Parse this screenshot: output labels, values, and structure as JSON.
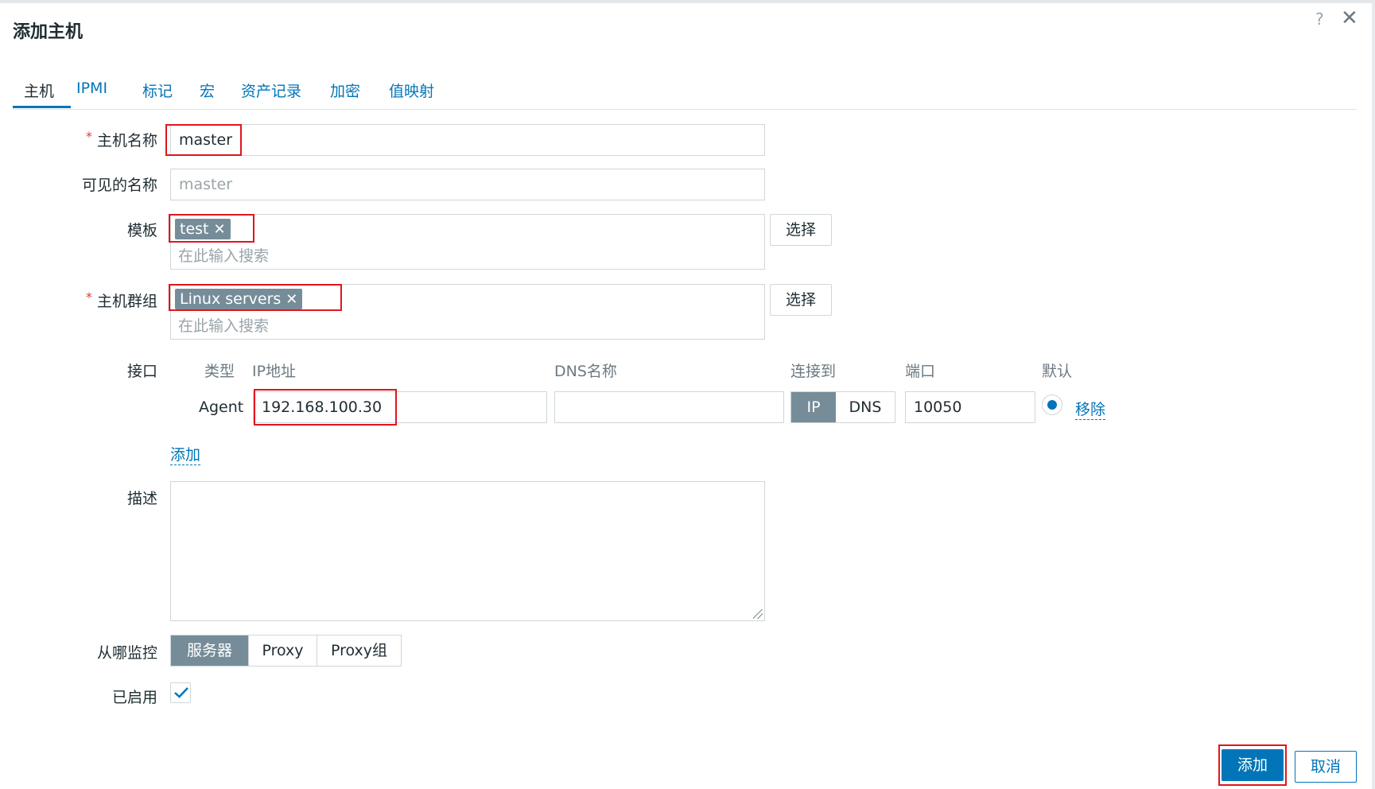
{
  "dialog": {
    "title": "添加主机",
    "help_icon": "?",
    "close_icon": "✕"
  },
  "tabs": [
    {
      "label": "主机"
    },
    {
      "label": "IPMI"
    },
    {
      "label": "标记"
    },
    {
      "label": "宏"
    },
    {
      "label": "资产记录"
    },
    {
      "label": "加密"
    },
    {
      "label": "值映射"
    }
  ],
  "form": {
    "required_mark": "*",
    "hostname": {
      "label": "主机名称",
      "value": "master"
    },
    "visible_name": {
      "label": "可见的名称",
      "placeholder": "master"
    },
    "templates": {
      "label": "模板",
      "tags": [
        "test"
      ],
      "search_placeholder": "在此输入搜索",
      "select_button": "选择"
    },
    "host_groups": {
      "label": "主机群组",
      "tags": [
        "Linux servers"
      ],
      "search_placeholder": "在此输入搜索",
      "select_button": "选择"
    },
    "tag_remove_icon": "✕",
    "interfaces": {
      "label": "接口",
      "headers": {
        "type": "类型",
        "ip": "IP地址",
        "dns": "DNS名称",
        "connect_to": "连接到",
        "port": "端口",
        "default": "默认"
      },
      "row": {
        "type": "Agent",
        "ip": "192.168.100.30",
        "dns": "",
        "connect_options": [
          "IP",
          "DNS"
        ],
        "connect_selected": "IP",
        "port": "10050",
        "remove": "移除"
      },
      "add_link": "添加"
    },
    "description": {
      "label": "描述",
      "value": ""
    },
    "monitored_by": {
      "label": "从哪监控",
      "options": [
        "服务器",
        "Proxy",
        "Proxy组"
      ],
      "selected": "服务器"
    },
    "enabled": {
      "label": "已启用",
      "checked": true
    }
  },
  "footer": {
    "add_button": "添加",
    "cancel_button": "取消"
  },
  "colors": {
    "accent": "#0275b8",
    "tag_bg": "#768d99",
    "required": "#e33734",
    "highlight_box": "#e0161c"
  }
}
